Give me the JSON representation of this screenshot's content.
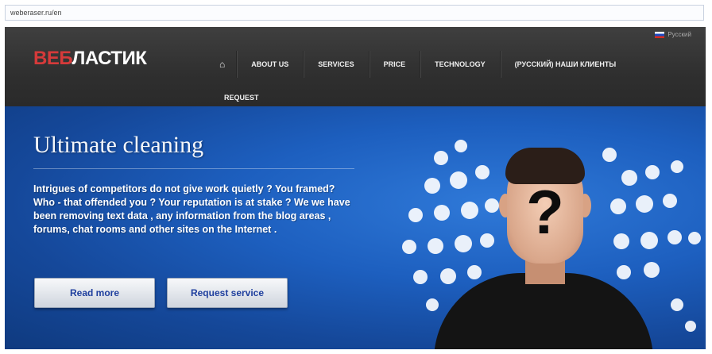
{
  "address_bar": {
    "url": "weberaser.ru/en"
  },
  "header": {
    "logo": {
      "part1": "ВЕБ",
      "part2": "ЛАСТИК"
    },
    "language": {
      "label": "Русский"
    },
    "nav": {
      "home_icon": "⌂",
      "items": [
        "ABOUT US",
        "SERVICES",
        "PRICE",
        "TECHNOLOGY",
        "(РУССКИЙ) НАШИ КЛИЕНТЫ"
      ],
      "row2": [
        "REQUEST"
      ]
    }
  },
  "hero": {
    "title": "Ultimate cleaning",
    "description": "Intrigues of competitors do not give work quietly ? You framed? Who - that offended you ? Your reputation is at stake ? We we have been removing text data , any information from the blog areas , forums, chat rooms and other sites on the Internet .",
    "buttons": {
      "read_more": "Read more",
      "request_service": "Request service"
    },
    "figure_symbol": "?"
  },
  "colors": {
    "accent_red": "#d63a3a",
    "hero_blue": "#1d5fbf",
    "button_text": "#1f3f9e",
    "header_bg": "#333333"
  }
}
